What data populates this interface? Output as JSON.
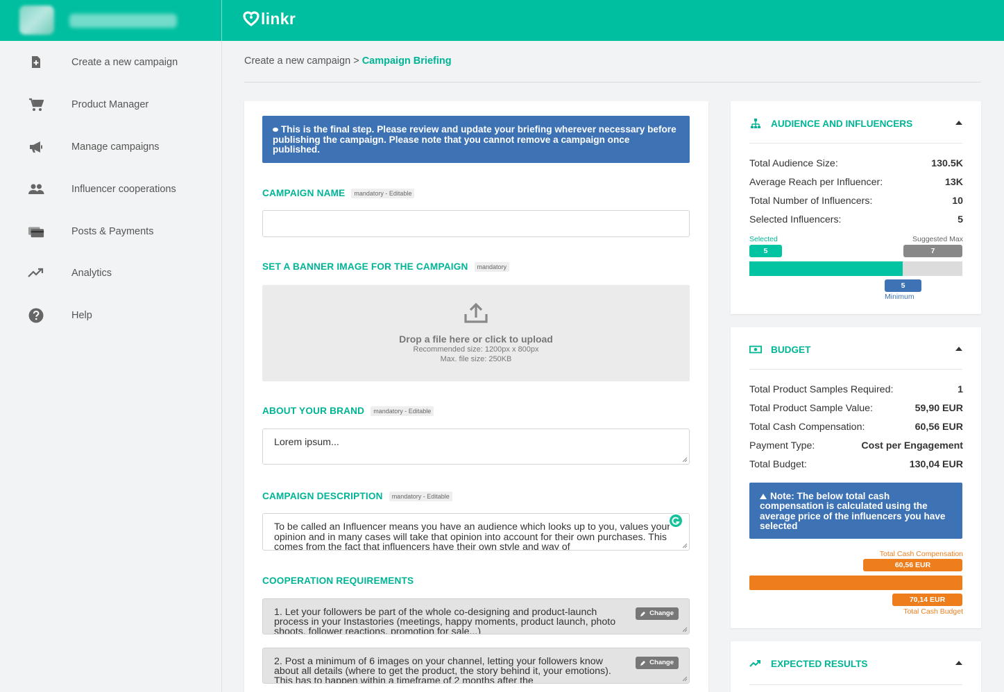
{
  "app": {
    "logo_text": "linkr"
  },
  "sidebar": {
    "items": [
      {
        "label": "Create a new campaign",
        "icon": "add-document-icon"
      },
      {
        "label": "Product Manager",
        "icon": "cart-icon"
      },
      {
        "label": "Manage campaigns",
        "icon": "megaphone-icon"
      },
      {
        "label": "Influencer cooperations",
        "icon": "people-icon"
      },
      {
        "label": "Posts & Payments",
        "icon": "payments-icon"
      },
      {
        "label": "Analytics",
        "icon": "trending-up-icon"
      },
      {
        "label": "Help",
        "icon": "help-icon"
      }
    ]
  },
  "breadcrumb": {
    "parent": "Create a new campaign",
    "separator": ">",
    "current": "Campaign Briefing"
  },
  "form": {
    "info_banner": "This is the final step. Please review and update your briefing wherever necessary before publishing the campaign. Please note that you cannot remove a campaign once published.",
    "campaign_name": {
      "label": "CAMPAIGN NAME",
      "tag": "mandatory - Editable",
      "value": ""
    },
    "banner": {
      "label": "SET A BANNER IMAGE FOR THE CAMPAIGN",
      "tag": "mandatory",
      "upload_title": "Drop a file here or click to upload",
      "upload_size": "Recommended size: 1200px x 800px",
      "upload_max": "Max. file size: 250KB"
    },
    "about_brand": {
      "label": "ABOUT YOUR BRAND",
      "tag": "mandatory - Editable",
      "value": "Lorem ipsum..."
    },
    "description": {
      "label": "CAMPAIGN DESCRIPTION",
      "tag": "mandatory - Editable",
      "value": "To be called an Influencer means you have an audience which looks up to you, values your opinion and in many cases will take that opinion into account for their own purchases. This comes from the fact that influencers have their own style and way of"
    },
    "requirements": {
      "label": "COOPERATION REQUIREMENTS",
      "change_label": "Change",
      "items": [
        "1. Let your followers be part of the whole co-designing and product-launch process in your Instastories (meetings, happy moments, product launch, photo shoots, follower reactions, promotion for sale...)",
        "2. Post a minimum of 6 images on your channel, letting your followers know about all details (where to get the product, the story behind it, your emotions). This has to happen within a timeframe of 2 months after the"
      ]
    }
  },
  "audience_panel": {
    "title": "AUDIENCE AND INFLUENCERS",
    "rows": [
      {
        "label": "Total Audience Size:",
        "value": "130.5K"
      },
      {
        "label": "Average Reach per Influencer:",
        "value": "13K"
      },
      {
        "label": "Total Number of Influencers:",
        "value": "10"
      },
      {
        "label": "Selected Influencers:",
        "value": "5"
      }
    ],
    "bar": {
      "selected_label": "Selected",
      "selected_value": "5",
      "suggested_label": "Suggested Max",
      "suggested_value": "7",
      "minimum_label": "Minimum",
      "minimum_value": "5",
      "fill_fraction": 0.72
    }
  },
  "budget_panel": {
    "title": "BUDGET",
    "rows": [
      {
        "label": "Total Product Samples Required:",
        "value": "1"
      },
      {
        "label": "Total Product Sample Value:",
        "value": "59,90 EUR"
      },
      {
        "label": "Total Cash Compensation:",
        "value": "60,56 EUR"
      },
      {
        "label": "Payment Type:",
        "value": "Cost per Engagement"
      },
      {
        "label": "Total Budget:",
        "value": "130,04 EUR"
      }
    ],
    "note": "Note: The below total cash compensation is calculated using the average price of the influencers you have selected",
    "bar": {
      "top_label": "Total Cash Compensation",
      "top_value": "60,56 EUR",
      "bottom_value": "70,14 EUR",
      "bottom_label": "Total Cash Budget"
    }
  },
  "results_panel": {
    "title": "EXPECTED RESULTS"
  },
  "colors": {
    "brand": "#00bfa0",
    "accent_text": "#00b496",
    "info_blue": "#3d72b4",
    "orange": "#ee7d1c",
    "grey_bubble": "#888888"
  }
}
